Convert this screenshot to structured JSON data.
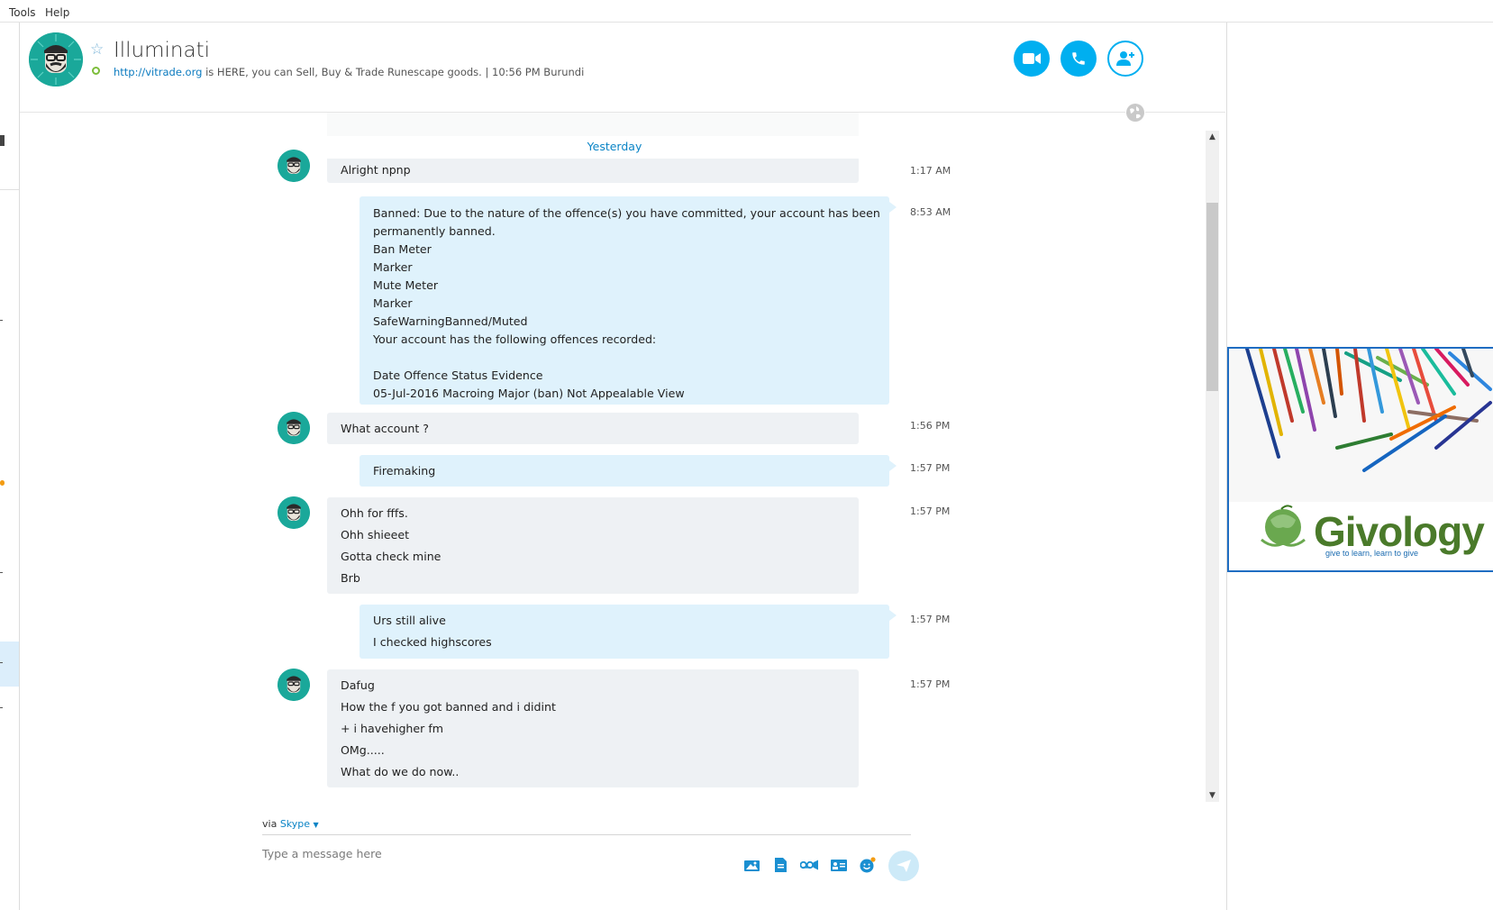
{
  "menu": {
    "tools": "Tools",
    "help": "Help"
  },
  "conversation": {
    "title": "Illuminati",
    "mood_link": "http://vitrade.org",
    "mood_text": " is HERE, you can Sell, Buy & Trade Runescape goods.  |  10:56 PM Burundi",
    "presence_color": "#7cbd3a"
  },
  "header_buttons": {
    "video": "video-call-icon",
    "call": "phone-call-icon",
    "add": "add-contact-icon"
  },
  "chat": {
    "date_separator": "Yesterday",
    "messages": [
      {
        "sender": "them",
        "time": "1:17 AM",
        "lines": [
          "Alright npnp"
        ]
      },
      {
        "sender": "me",
        "time": "8:53 AM",
        "lines": [
          "Banned: Due to the nature of the offence(s) you have committed, your account has been",
          "permanently banned.",
          "Ban Meter",
          "Marker",
          "Mute Meter",
          "Marker",
          "SafeWarningBanned/Muted",
          "Your account has the following offences recorded:",
          "",
          "Date Offence Status Evidence",
          "05-Jul-2016 Macroing Major (ban) Not Appealable View"
        ]
      },
      {
        "sender": "them",
        "time": "1:56 PM",
        "lines": [
          "What account ?"
        ]
      },
      {
        "sender": "me",
        "time": "1:57 PM",
        "lines": [
          "Firemaking"
        ]
      },
      {
        "sender": "them",
        "time": "1:57 PM",
        "lines": [
          "Ohh for fffs.",
          "Ohh shieeet",
          "Gotta check mine",
          "Brb"
        ]
      },
      {
        "sender": "me",
        "time": "1:57 PM",
        "lines": [
          "Urs still alive",
          "I checked highscores"
        ]
      },
      {
        "sender": "them",
        "time": "1:57 PM",
        "lines": [
          "Dafug",
          "How the f you got banned and i didint",
          "+ i havehigher fm",
          "OMg.....",
          "What do we do now.."
        ]
      }
    ]
  },
  "composer": {
    "via": "via",
    "service": "Skype",
    "placeholder": "Type a message here",
    "icons": [
      "send-photo-icon",
      "send-file-icon",
      "video-message-icon",
      "send-contact-icon",
      "emoticon-icon",
      "send-icon"
    ]
  },
  "ad": {
    "brand": "Givology",
    "tagline": "give to learn, learn to give"
  },
  "colors": {
    "accent": "#00aff0",
    "incoming_bubble": "#eef1f4",
    "outgoing_bubble": "#dff2fc",
    "avatar": "#1aa89a"
  }
}
